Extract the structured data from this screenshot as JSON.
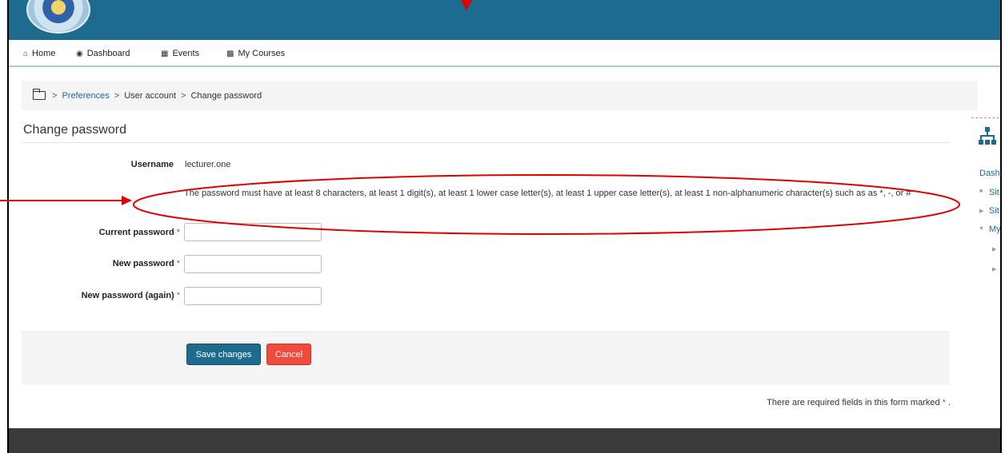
{
  "nav": {
    "items": [
      {
        "label": "Home",
        "icon": "home-icon"
      },
      {
        "label": "Dashboard",
        "icon": "dashboard-icon"
      },
      {
        "label": "Events",
        "icon": "calendar-icon"
      },
      {
        "label": "My Courses",
        "icon": "briefcase-icon"
      }
    ]
  },
  "breadcrumb": {
    "separator": ">",
    "items": [
      "Preferences",
      "User account",
      "Change password"
    ]
  },
  "page": {
    "title": "Change password"
  },
  "form": {
    "username_label": "Username",
    "username_value": "lecturer.one",
    "policy_text": "The password must have at least 8 characters, at least 1 digit(s), at least 1 lower case letter(s), at least 1 upper case letter(s), at least 1 non-alphanumeric character(s) such as as *, -, or #",
    "current_password_label": "Current password",
    "new_password_label": "New password",
    "new_password_again_label": "New password (again)",
    "required_marker": "*",
    "save_label": "Save changes",
    "cancel_label": "Cancel",
    "required_note": "There are required fields in this form marked"
  },
  "sidebar": {
    "items": [
      {
        "label": "Dash"
      },
      {
        "label": "Sit"
      },
      {
        "label": "Sit"
      },
      {
        "label": "My"
      }
    ]
  },
  "colors": {
    "topbar": "#1d6b8f",
    "nav_underline": "#9fd3c8",
    "link": "#1d6b8f",
    "save_button": "#1d6b8f",
    "cancel_button": "#f04a3c",
    "required": "#e0392b",
    "footer": "#3a3a3a",
    "annotation": "#e00000"
  }
}
